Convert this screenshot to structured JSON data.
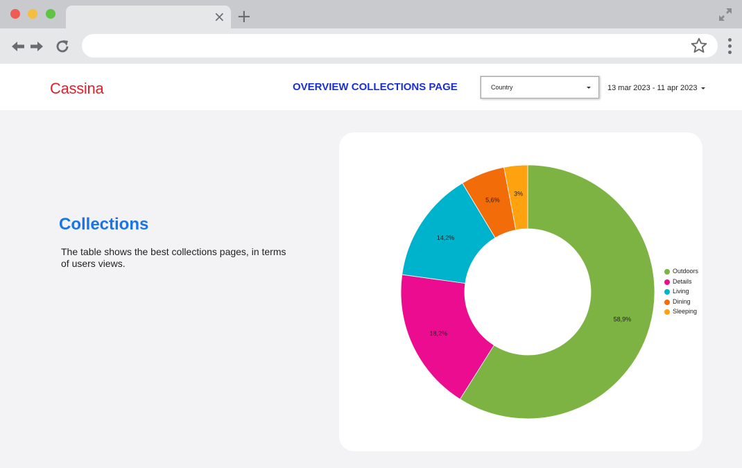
{
  "browser": {
    "traffic_colors": [
      "#ee5c55",
      "#f5be40",
      "#5fc443"
    ],
    "tab_close_symbol": "×",
    "new_tab_symbol": "+",
    "address_value": ""
  },
  "header": {
    "logo": "Cassina",
    "title": "OVERVIEW COLLECTIONS PAGE",
    "country_filter": "Country",
    "date_range": "13 mar 2023 - 11 apr 2023"
  },
  "section": {
    "title": "Collections",
    "description": "The table shows the best collections pages, in terms of users views."
  },
  "chart_data": {
    "type": "pie",
    "donut": true,
    "categories": [
      "Outdoors",
      "Details",
      "Living",
      "Dining",
      "Sleeping"
    ],
    "values": [
      58.9,
      18.2,
      14.2,
      5.6,
      3
    ],
    "labels": [
      "58,9%",
      "18,2%",
      "14,2%",
      "5,6%",
      "3%"
    ],
    "colors": [
      "#7cb342",
      "#ec0c8f",
      "#00b3cc",
      "#f36c0a",
      "#ffa20f"
    ],
    "legend_position": "right"
  }
}
